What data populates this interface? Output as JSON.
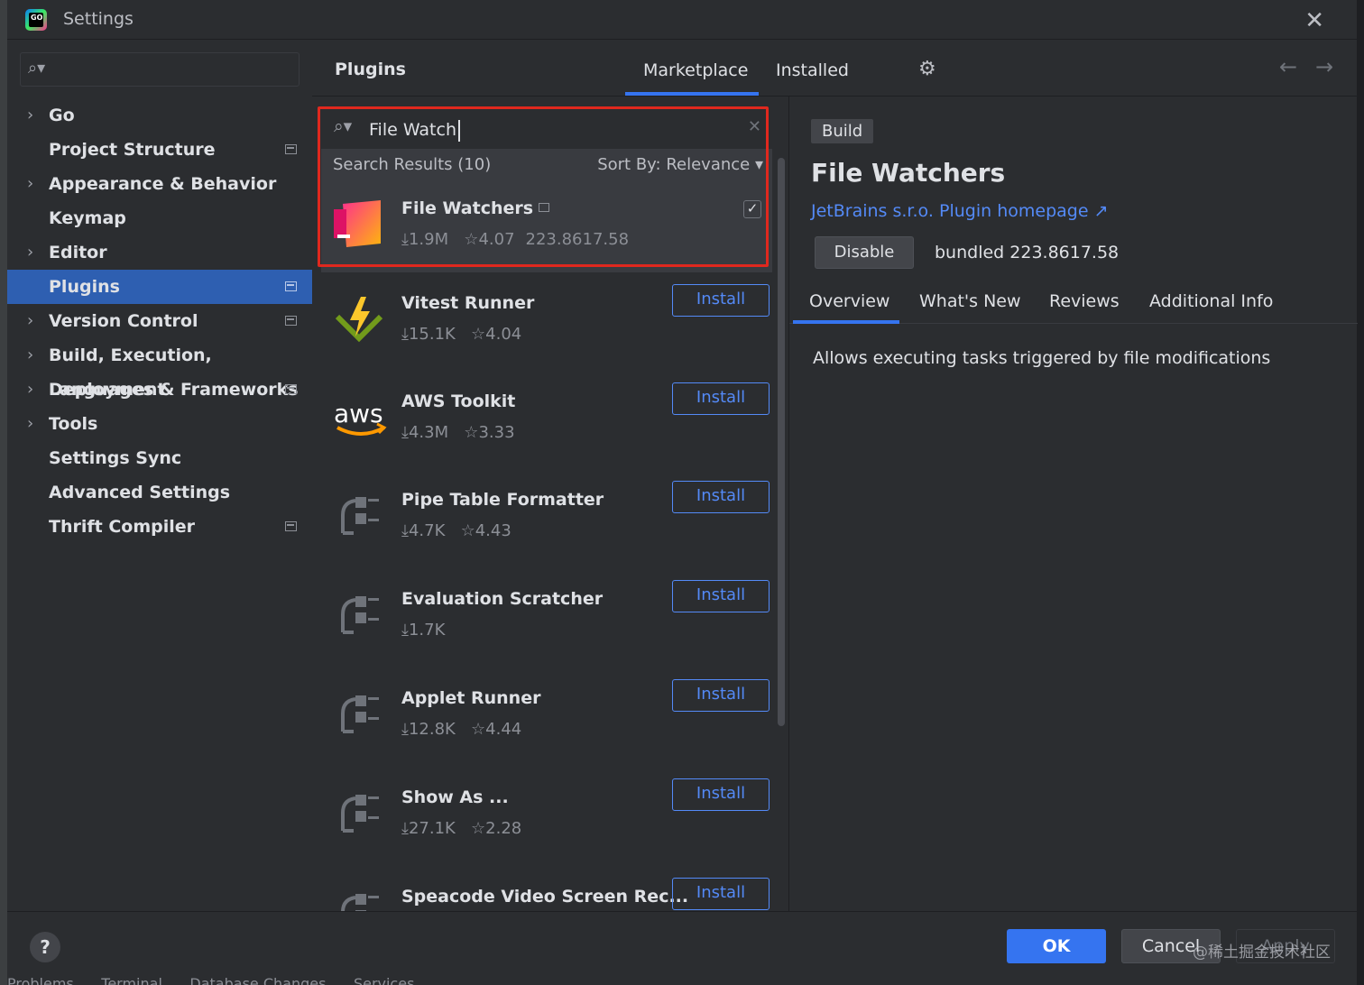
{
  "window": {
    "title": "Settings"
  },
  "sidebar": {
    "items": [
      {
        "label": "Go",
        "expandable": true,
        "project": false,
        "selected": false
      },
      {
        "label": "Project Structure",
        "expandable": false,
        "project": true,
        "selected": false
      },
      {
        "label": "Appearance & Behavior",
        "expandable": true,
        "project": false,
        "selected": false
      },
      {
        "label": "Keymap",
        "expandable": false,
        "project": false,
        "selected": false
      },
      {
        "label": "Editor",
        "expandable": true,
        "project": false,
        "selected": false
      },
      {
        "label": "Plugins",
        "expandable": false,
        "project": true,
        "selected": true
      },
      {
        "label": "Version Control",
        "expandable": true,
        "project": true,
        "selected": false
      },
      {
        "label": "Build, Execution, Deployment",
        "expandable": true,
        "project": false,
        "selected": false
      },
      {
        "label": "Languages & Frameworks",
        "expandable": true,
        "project": true,
        "selected": false
      },
      {
        "label": "Tools",
        "expandable": true,
        "project": false,
        "selected": false
      },
      {
        "label": "Settings Sync",
        "expandable": false,
        "project": false,
        "selected": false
      },
      {
        "label": "Advanced Settings",
        "expandable": false,
        "project": false,
        "selected": false
      },
      {
        "label": "Thrift Compiler",
        "expandable": false,
        "project": true,
        "selected": false
      }
    ]
  },
  "plugins": {
    "title": "Plugins",
    "tabs": {
      "marketplace": "Marketplace",
      "installed": "Installed"
    },
    "search": {
      "value": "File Watch"
    },
    "results_label": "Search Results (10)",
    "sort_label": "Sort By: Relevance",
    "list": [
      {
        "name": "File Watchers",
        "downloads": "1.9M",
        "rating": "4.07",
        "version": "223.8617.58",
        "installed": true,
        "icon": "file-watchers-icon"
      },
      {
        "name": "Vitest Runner",
        "downloads": "15.1K",
        "rating": "4.04",
        "action": "Install",
        "icon": "vitest-icon"
      },
      {
        "name": "AWS Toolkit",
        "downloads": "4.3M",
        "rating": "3.33",
        "action": "Install",
        "icon": "aws-icon"
      },
      {
        "name": "Pipe Table Formatter",
        "downloads": "4.7K",
        "rating": "4.43",
        "action": "Install",
        "icon": "plugin-plug-icon"
      },
      {
        "name": "Evaluation Scratcher",
        "downloads": "1.7K",
        "rating": "",
        "action": "Install",
        "icon": "plugin-plug-icon"
      },
      {
        "name": "Applet Runner",
        "downloads": "12.8K",
        "rating": "4.44",
        "action": "Install",
        "icon": "plugin-plug-icon"
      },
      {
        "name": "Show As ...",
        "downloads": "27.1K",
        "rating": "2.28",
        "action": "Install",
        "icon": "plugin-plug-icon"
      },
      {
        "name": "Speacode Video Screen Rec...",
        "downloads": "",
        "rating": "",
        "action": "Install",
        "icon": "plugin-plug-icon"
      }
    ]
  },
  "detail": {
    "category": "Build",
    "title": "File Watchers",
    "vendor": "JetBrains s.r.o.",
    "homepage": "Plugin homepage ↗",
    "disable_label": "Disable",
    "bundled": "bundled 223.8617.58",
    "tabs": [
      "Overview",
      "What's New",
      "Reviews",
      "Additional Info"
    ],
    "description": "Allows executing tasks triggered by file modifications"
  },
  "footer": {
    "help": "?",
    "ok": "OK",
    "cancel": "Cancel",
    "apply": "Apply",
    "watermark": "@稀土掘金技术社区"
  },
  "statusbar": "Problems      Terminal      Database Changes      Services",
  "colors": {
    "accent": "#3574f0",
    "link": "#548af7",
    "highlight_frame": "#e0281e",
    "selection": "#2e5fb1"
  }
}
